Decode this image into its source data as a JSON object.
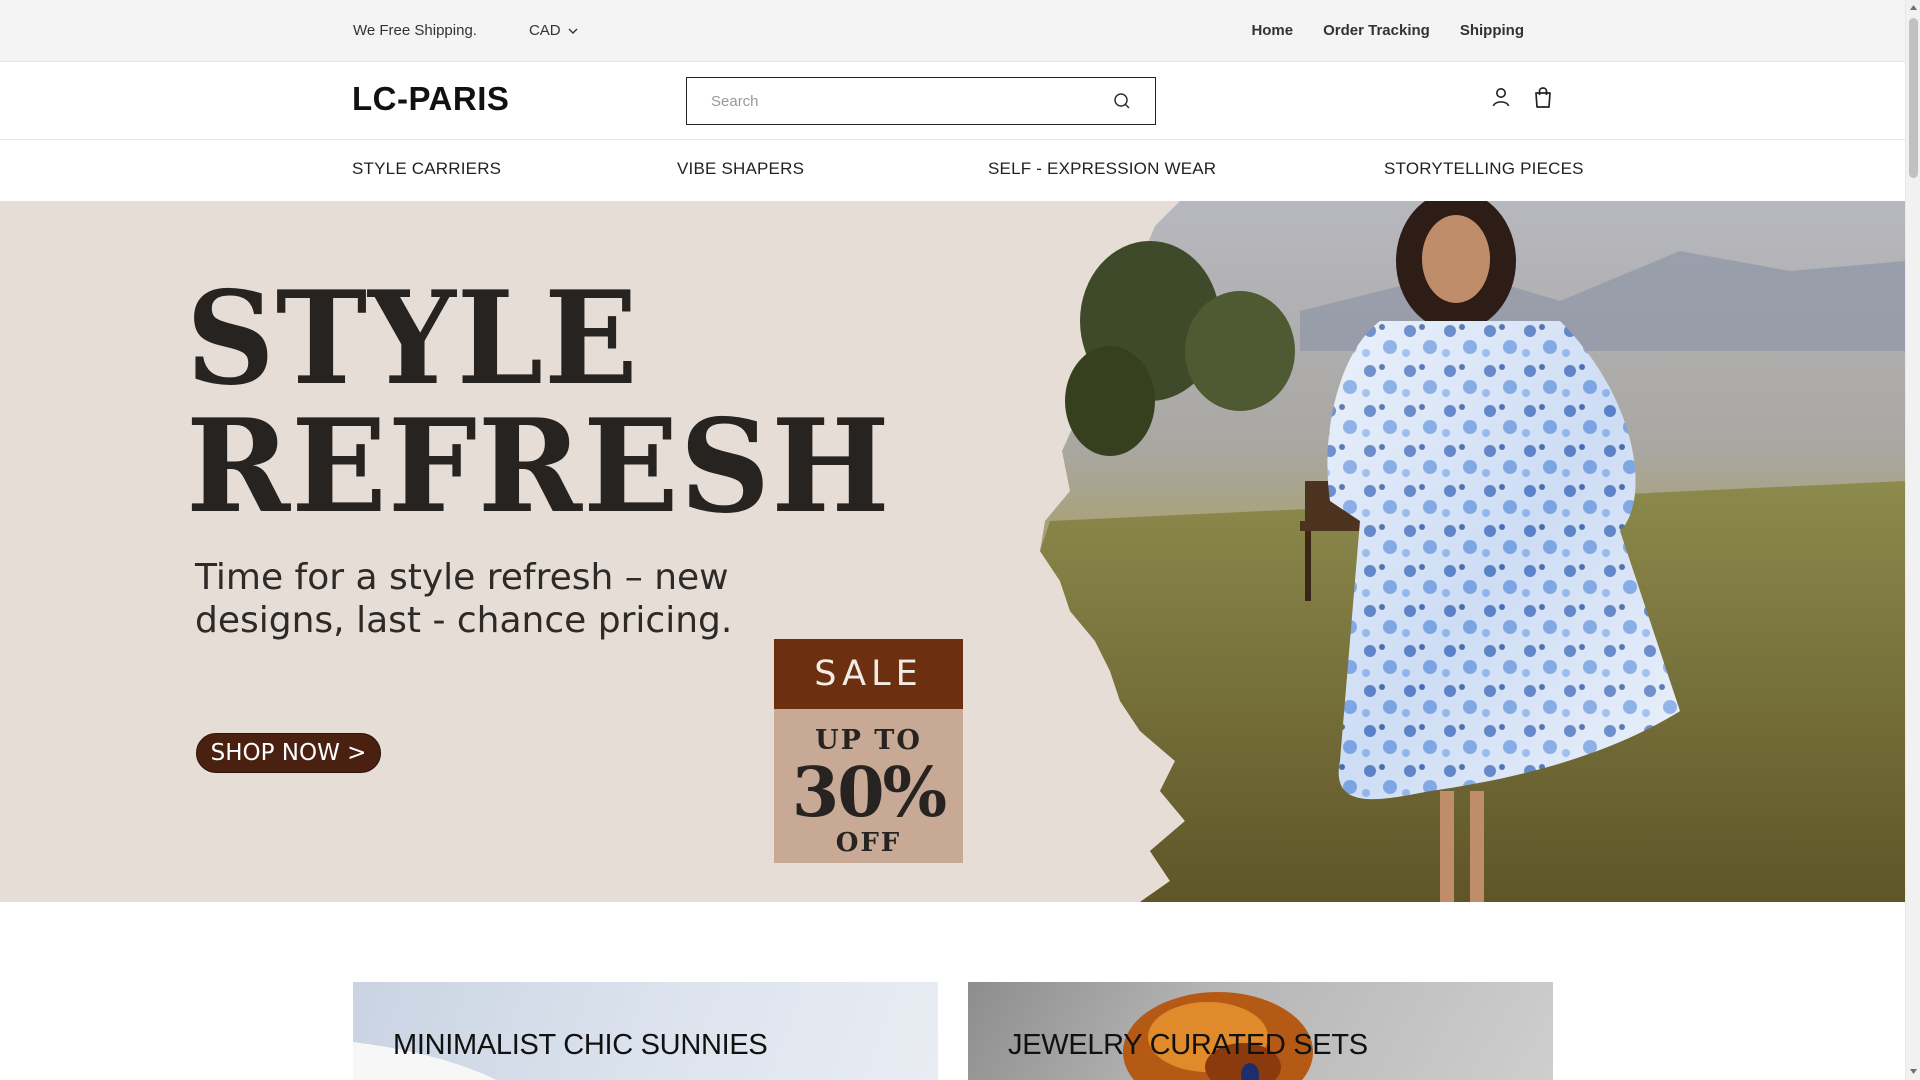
{
  "topbar": {
    "shipping_note": "We Free Shipping.",
    "currency": "CAD",
    "links": [
      "Home",
      "Order Tracking",
      "Shipping"
    ]
  },
  "header": {
    "logo": "LC-PARIS",
    "search_placeholder": "Search",
    "icons": [
      "user-icon",
      "bag-icon"
    ]
  },
  "nav": {
    "items": [
      "STYLE CARRIERS",
      "VIBE SHAPERS",
      "SELF - EXPRESSION WEAR",
      "STORYTELLING PIECES"
    ]
  },
  "hero": {
    "title_line1": "STYLE",
    "title_line2": "REFRESH",
    "subtitle": "Time for a style refresh – new designs, last - chance pricing.",
    "button": "SHOP NOW >",
    "sale": {
      "label": "SALE",
      "up_to": "UP TO",
      "percent": "30%",
      "off": "OFF"
    }
  },
  "cards": [
    {
      "label": "MINIMALIST CHIC SUNNIES"
    },
    {
      "label": "JEWELRY CURATED SETS"
    }
  ],
  "colors": {
    "hero_bg": "#e6ded6",
    "sale_top": "#6c3010",
    "sale_bottom": "#c7a996",
    "button": "#4a2010"
  }
}
